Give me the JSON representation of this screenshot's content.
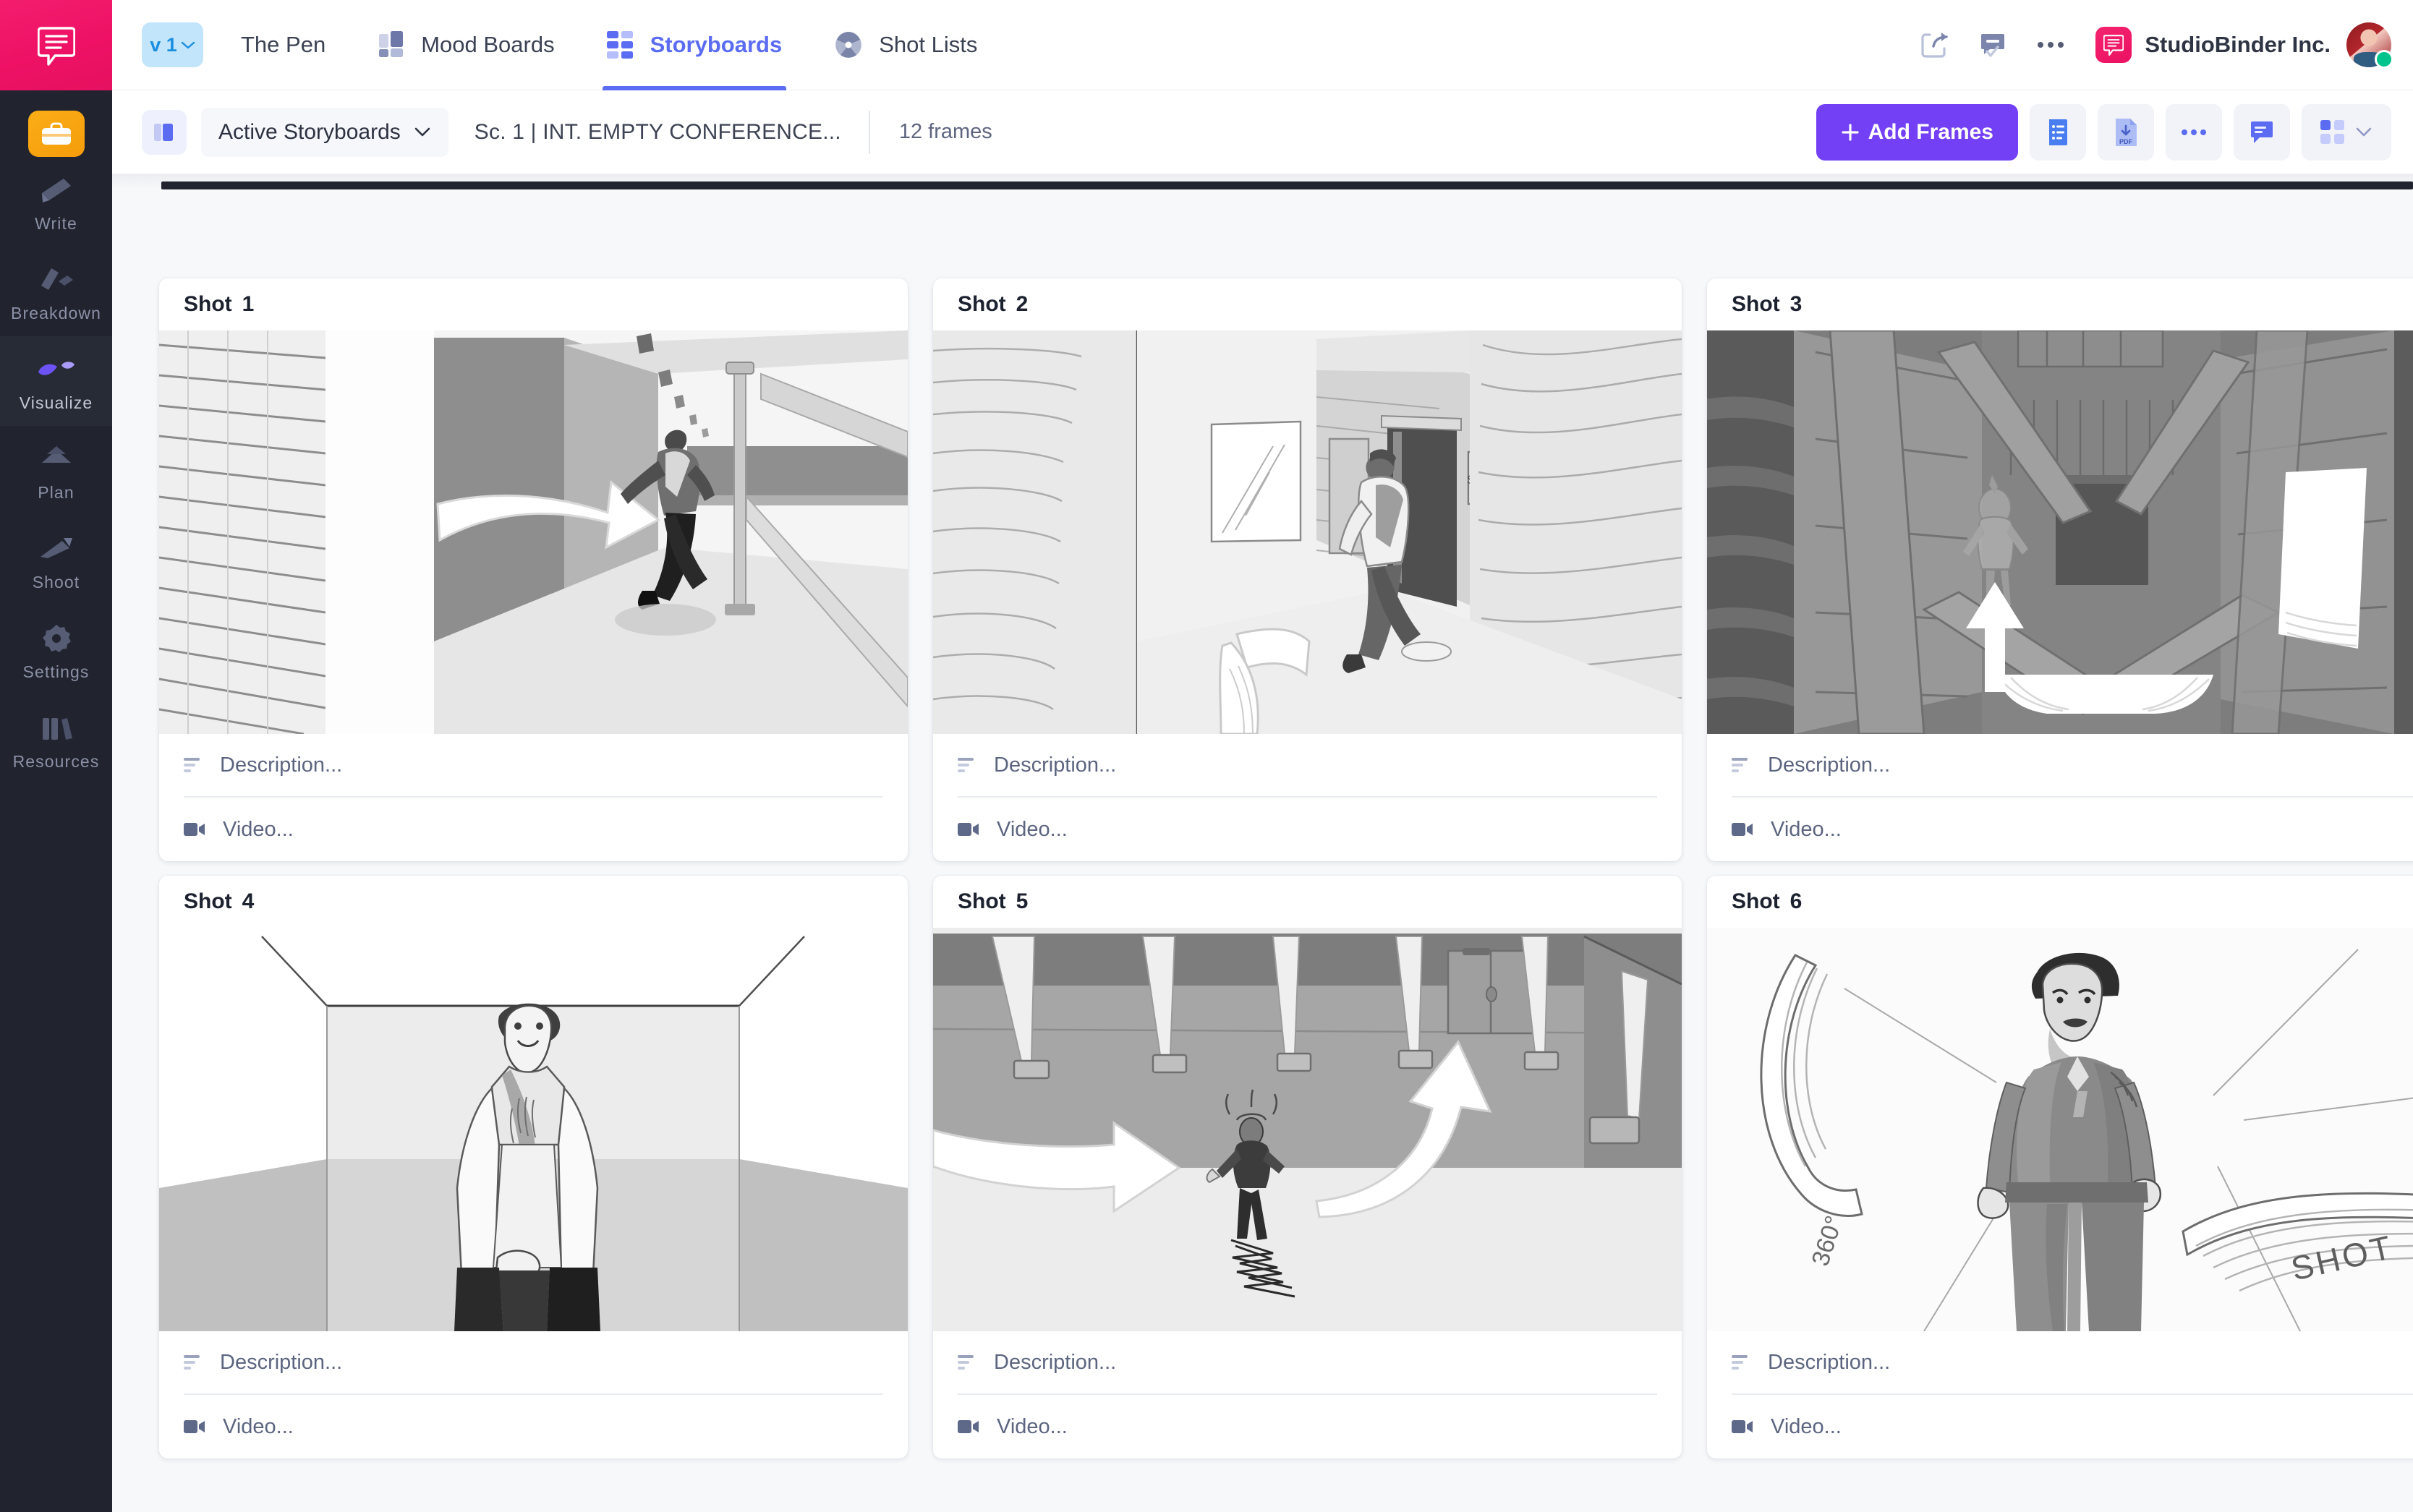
{
  "brand": {
    "logo_icon": "studiobinder-speech-logo",
    "accent_pink": "#ee1165",
    "accent_purple": "#7340f5",
    "accent_blue": "#5b6cf2"
  },
  "left_rail": {
    "app_badge_icon": "briefcase-icon",
    "items": [
      {
        "label": "Write",
        "icon": "pencil-icon",
        "active": false
      },
      {
        "label": "Breakdown",
        "icon": "layers-icon",
        "active": false
      },
      {
        "label": "Visualize",
        "icon": "shapes-icon",
        "active": true
      },
      {
        "label": "Plan",
        "icon": "calendar-icon",
        "active": false
      },
      {
        "label": "Shoot",
        "icon": "megaphone-icon",
        "active": false
      },
      {
        "label": "Settings",
        "icon": "gear-icon",
        "active": false
      },
      {
        "label": "Resources",
        "icon": "books-icon",
        "active": false
      }
    ]
  },
  "topbar": {
    "version_label": "v 1",
    "version_caret_icon": "chevron-down-icon",
    "tabs": [
      {
        "label": "The Pen",
        "icon": "pen-project-icon",
        "active": false
      },
      {
        "label": "Mood Boards",
        "icon": "mood-board-icon",
        "active": false
      },
      {
        "label": "Storyboards",
        "icon": "storyboard-grid-icon",
        "active": true
      },
      {
        "label": "Shot Lists",
        "icon": "aperture-icon",
        "active": false
      }
    ],
    "actions": [
      {
        "name": "share-button",
        "icon": "share-icon"
      },
      {
        "name": "notifications-button",
        "icon": "comment-check-icon"
      },
      {
        "name": "more-options-button",
        "icon": "ellipsis-icon"
      }
    ],
    "org_name": "StudioBinder Inc.",
    "org_logo_icon": "studiobinder-speech-logo",
    "avatar_name": "user-avatar",
    "avatar_status": "online"
  },
  "subbar": {
    "layout_toggle_icon": "panel-toggle-icon",
    "filter_label": "Active Storyboards",
    "filter_caret_icon": "chevron-down-icon",
    "scene_title": "Sc. 1 | INT. EMPTY CONFERENCE...",
    "frame_count": "12 frames",
    "add_frames_label": "Add Frames",
    "add_frames_plus_icon": "plus-icon",
    "tools": [
      {
        "name": "shot-list-view-button",
        "icon": "document-list-icon"
      },
      {
        "name": "export-pdf-button",
        "icon": "pdf-download-icon",
        "label": "PDF"
      },
      {
        "name": "more-tools-button",
        "icon": "ellipsis-icon"
      },
      {
        "name": "comments-button",
        "icon": "comment-icon"
      },
      {
        "name": "grid-view-button",
        "icon": "grid-icon",
        "caret_icon": "chevron-down-icon"
      }
    ]
  },
  "board": {
    "description_placeholder": "Description...",
    "description_icon": "text-lines-icon",
    "video_placeholder": "Video...",
    "video_icon": "video-camera-icon",
    "shots": [
      {
        "label": "Shot",
        "number": "1",
        "art": "corridor-blinds-running-man"
      },
      {
        "label": "Shot",
        "number": "2",
        "art": "hallway-stairs-door-running-man"
      },
      {
        "label": "Shot",
        "number": "3",
        "art": "attic-rafters-figure-up-arrow"
      },
      {
        "label": "Shot",
        "number": "4",
        "art": "man-facing-camera-corner-room"
      },
      {
        "label": "Shot",
        "number": "5",
        "art": "parking-garage-arrows-woman"
      },
      {
        "label": "Shot",
        "number": "6",
        "art": "suit-man-360-shot-sweep",
        "annotations": [
          "360°",
          "SHOT"
        ]
      }
    ]
  }
}
